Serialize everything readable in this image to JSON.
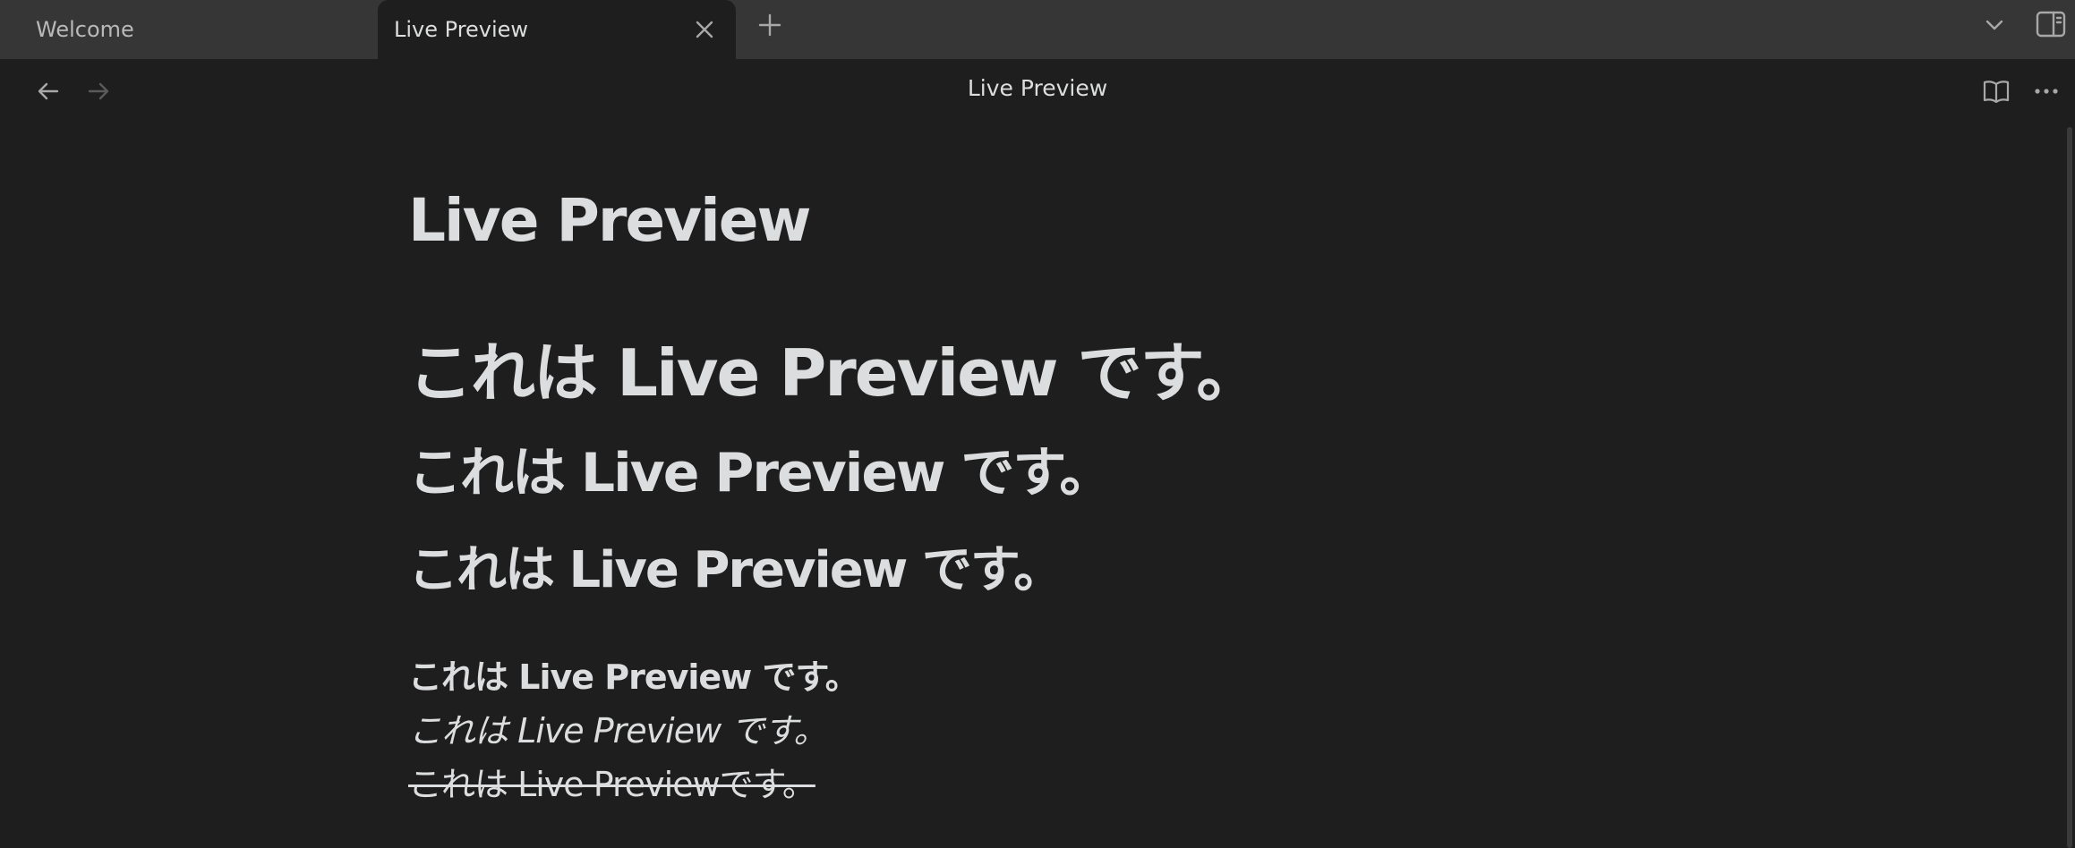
{
  "tabs": [
    {
      "label": "Welcome",
      "active": false
    },
    {
      "label": "Live Preview",
      "active": true
    }
  ],
  "header": {
    "title": "Live Preview"
  },
  "note": {
    "inline_title": "Live Preview",
    "heading1": "これは Live Preview です。",
    "heading2": "これは Live Preview です。",
    "heading3": "これは Live Preview です。",
    "bold_text": "これは Live Preview です。",
    "italic_text": "これは Live Preview  です。",
    "strikethrough_text": "これは Live Previewです。"
  },
  "icons": {
    "tab_close": "close-icon",
    "new_tab": "plus-icon",
    "tab_list": "chevron-down-icon",
    "sidebar_toggle": "sidebar-right-icon",
    "back": "arrow-left-icon",
    "forward": "arrow-right-icon",
    "reading_view": "book-open-icon",
    "more_options": "ellipsis-icon"
  },
  "colors": {
    "background": "#1e1e1e",
    "tab_bar": "#363636",
    "text": "#dcddde",
    "muted_text": "#b9b9b9",
    "icon": "#a8a8a8",
    "disabled_icon": "#5a5a5a"
  }
}
